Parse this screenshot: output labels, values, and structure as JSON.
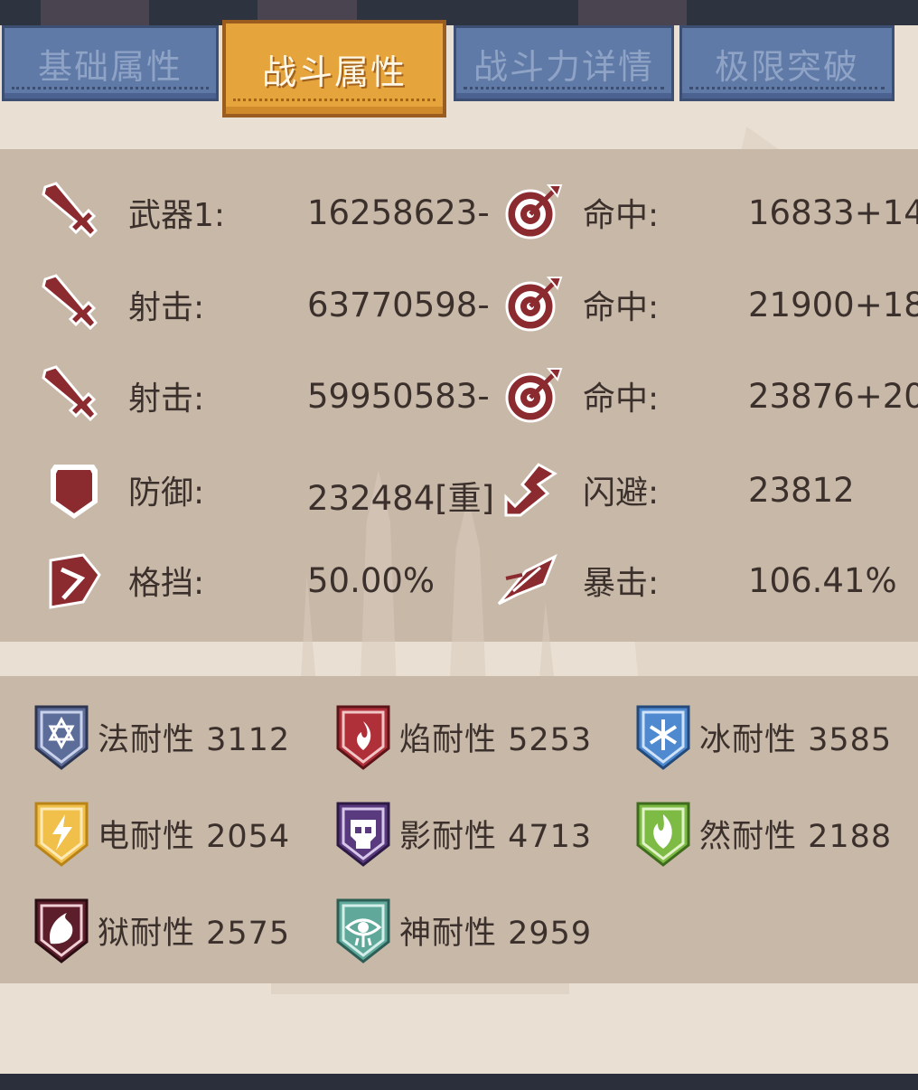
{
  "tabs": [
    {
      "label": "基础属性",
      "active": false
    },
    {
      "label": "战斗属性",
      "active": true
    },
    {
      "label": "战斗力详情",
      "active": false
    },
    {
      "label": "极限突破",
      "active": false
    }
  ],
  "stats": [
    {
      "left_icon": "sword-icon",
      "left_label": "武器1:",
      "left_value": "16258623-",
      "right_icon": "target-icon",
      "right_label": "命中:",
      "right_value": "16833+14"
    },
    {
      "left_icon": "sword-icon",
      "left_label": "射击:",
      "left_value": "63770598-",
      "right_icon": "target-icon",
      "right_label": "命中:",
      "right_value": "21900+18"
    },
    {
      "left_icon": "sword-icon",
      "left_label": "射击:",
      "left_value": "59950583-",
      "right_icon": "target-icon",
      "right_label": "命中:",
      "right_value": "23876+20"
    },
    {
      "left_icon": "shield-icon",
      "left_label": "防御:",
      "left_value": "232484[重]",
      "right_icon": "dodge-icon",
      "right_label": "闪避:",
      "right_value": "23812"
    },
    {
      "left_icon": "block-icon",
      "left_label": "格挡:",
      "left_value": "50.00%",
      "right_icon": "crit-icon",
      "right_label": "暴击:",
      "right_value": "106.41%"
    }
  ],
  "resistances": [
    {
      "icon": "star-of-david-icon",
      "text": "法耐性 3112",
      "color": "#5d6d9a"
    },
    {
      "icon": "flame-icon",
      "text": "焰耐性 5253",
      "color": "#b0303a"
    },
    {
      "icon": "snowflake-icon",
      "text": "冰耐性 3585",
      "color": "#4f8ad0"
    },
    {
      "icon": "lightning-icon",
      "text": "电耐性 2054",
      "color": "#f0c04a"
    },
    {
      "icon": "skull-icon",
      "text": "影耐性 4713",
      "color": "#5a3a7e"
    },
    {
      "icon": "nature-flame-icon",
      "text": "然耐性 2188",
      "color": "#7dbb45"
    },
    {
      "icon": "claw-icon",
      "text": "狱耐性 2575",
      "color": "#5b1e2a"
    },
    {
      "icon": "eye-icon",
      "text": "神耐性 2959",
      "color": "#5fa89a"
    }
  ],
  "colors": {
    "icon_red": "#8b2a2f",
    "tab_blue": "#5f7aa6",
    "tab_gold": "#e6a43c"
  }
}
